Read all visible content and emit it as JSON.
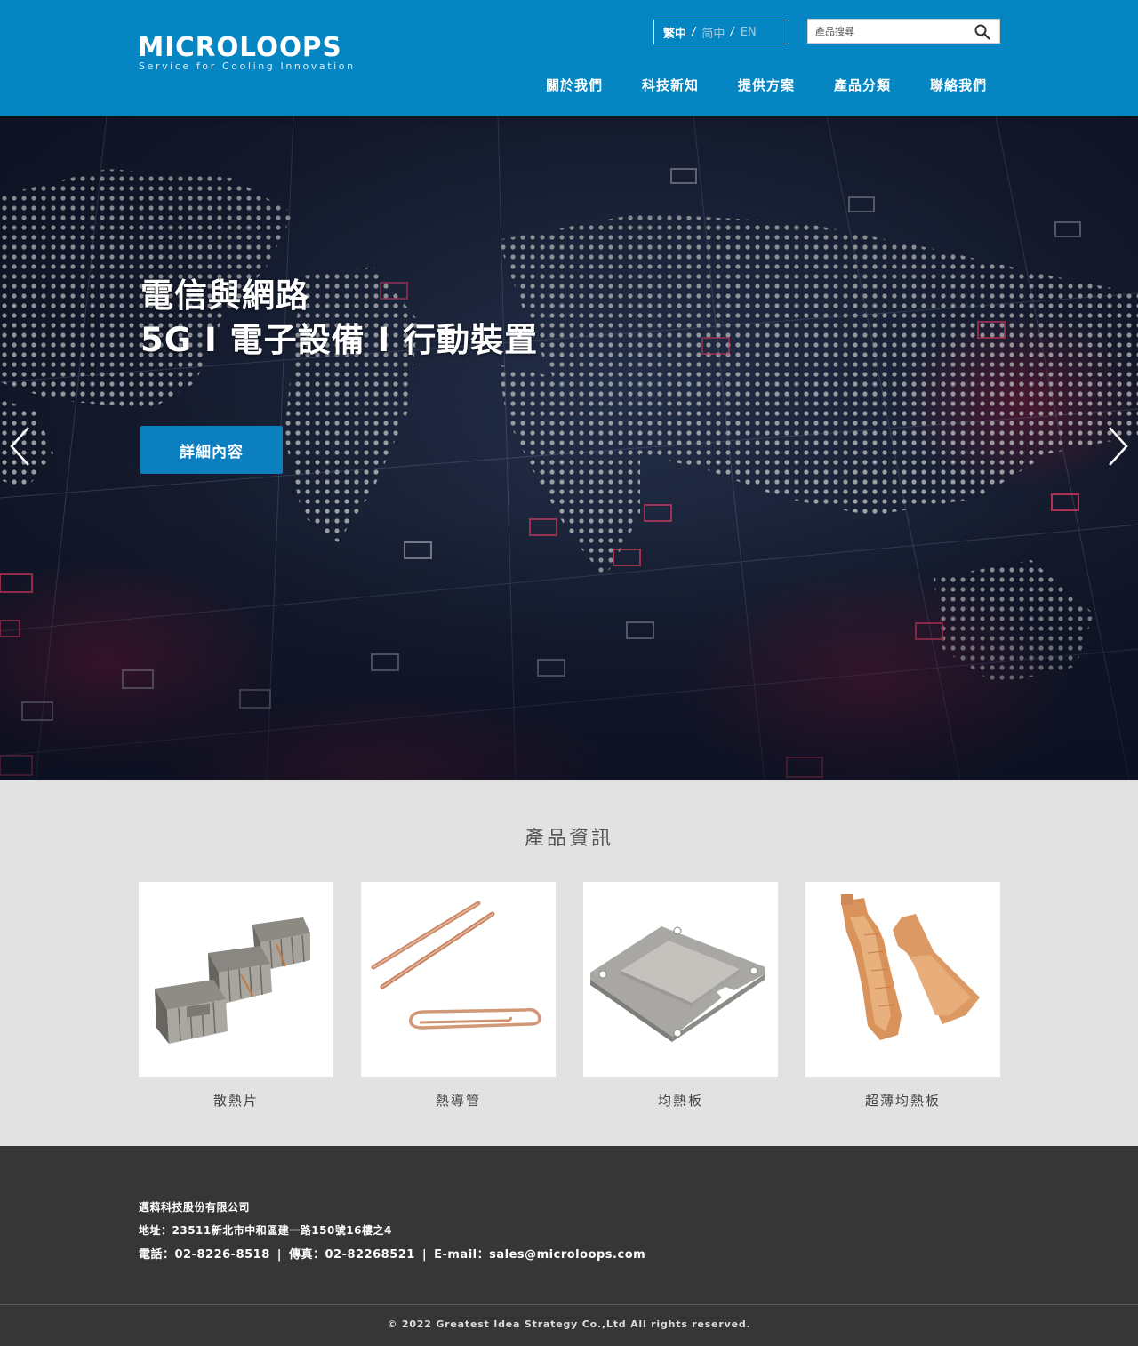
{
  "header": {
    "logo_text": "MICROLOOPS",
    "logo_tagline": "Service for Cooling Innovation",
    "languages": [
      "繁中",
      "简中",
      "EN"
    ],
    "active_language": "繁中",
    "search_placeholder": "產品搜尋",
    "nav": [
      "關於我們",
      "科技新知",
      "提供方案",
      "產品分類",
      "聯絡我們"
    ],
    "brand_color": "#0585c2"
  },
  "hero": {
    "title_line1": "電信與網路",
    "title_line2": "5G I 電子設備 I 行動裝置",
    "button_label": "詳細內容",
    "prev_icon": "chevron-left-icon",
    "next_icon": "chevron-right-icon"
  },
  "products": {
    "title": "產品資訊",
    "items": [
      {
        "label": "散熱片"
      },
      {
        "label": "熱導管"
      },
      {
        "label": "均熱板"
      },
      {
        "label": "超薄均熱板"
      }
    ]
  },
  "footer": {
    "company": "邁萪科技股份有限公司",
    "address": "地址：23511新北市中和區建一路150號16樓之4",
    "phone": "電話：02-8226-8518",
    "fax": "傳真：02-82268521",
    "email": "E-mail：sales@microloops.com",
    "copyright": "© 2022 Greatest Idea Strategy Co.,Ltd All rights reserved."
  }
}
